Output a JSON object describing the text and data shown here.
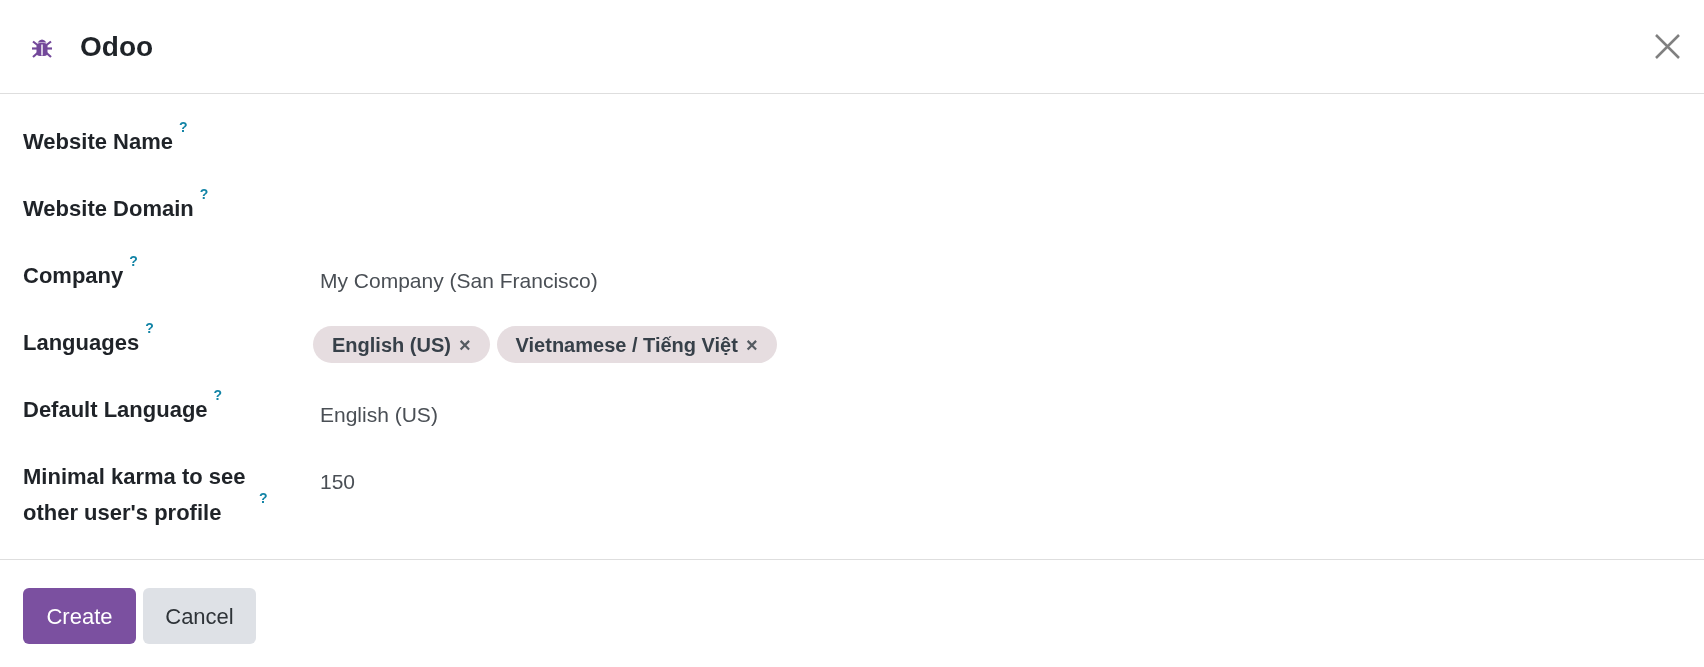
{
  "dialog": {
    "title": "Odoo"
  },
  "fields": [
    {
      "kind": "text",
      "label": "Website Name",
      "help": "?"
    },
    {
      "kind": "text",
      "label": "Website Domain",
      "help": "?"
    },
    {
      "kind": "text",
      "label": "Company",
      "help": "?",
      "value": "My Company (San Francisco)"
    },
    {
      "kind": "tags",
      "label": "Languages",
      "help": "?",
      "tags": [
        {
          "label": "English (US)",
          "remove": "×"
        },
        {
          "label": "Vietnamese / Tiếng Việt",
          "remove": "×"
        }
      ]
    },
    {
      "kind": "text",
      "label": "Default Language",
      "help": "?",
      "value": "English (US)"
    },
    {
      "kind": "text",
      "label": "Minimal karma to see other user's profile",
      "help": "?",
      "value": "150"
    }
  ],
  "buttons": [
    {
      "label": "Create",
      "kind": "primary"
    },
    {
      "label": "Cancel",
      "kind": "secondary"
    }
  ]
}
